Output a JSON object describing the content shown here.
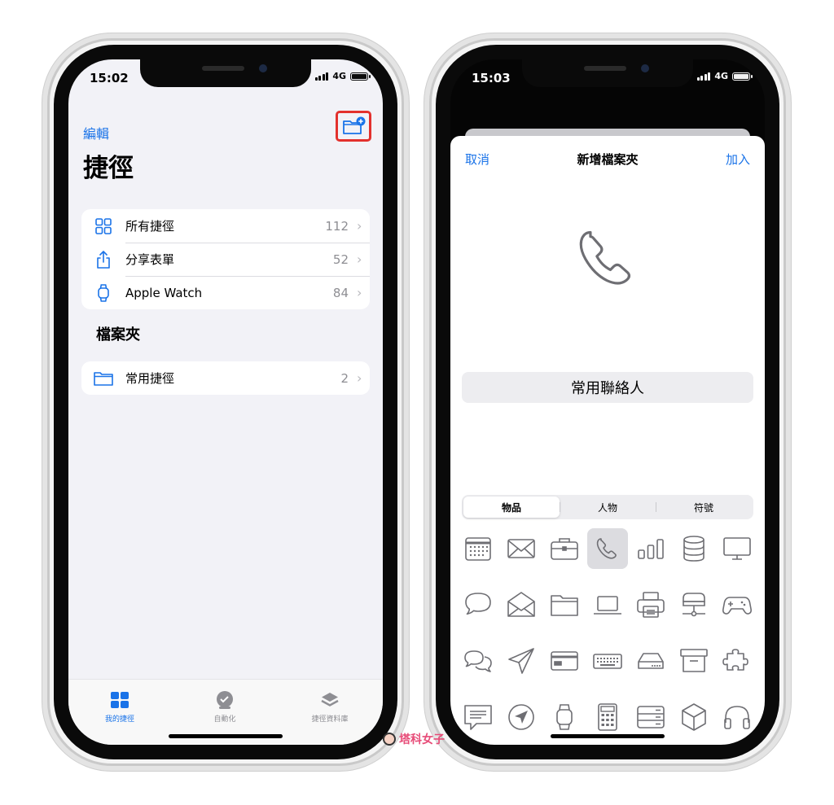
{
  "left_phone": {
    "status": {
      "time": "15:02",
      "network": "4G"
    },
    "header": {
      "edit": "編輯",
      "title": "捷徑",
      "new_folder_icon": "folder-badge-plus-icon"
    },
    "library": [
      {
        "icon": "grid-icon",
        "label": "所有捷徑",
        "count": "112"
      },
      {
        "icon": "share-icon",
        "label": "分享表單",
        "count": "52"
      },
      {
        "icon": "watch-icon",
        "label": "Apple Watch",
        "count": "84"
      }
    ],
    "folders_section": {
      "title": "檔案夾"
    },
    "folders": [
      {
        "icon": "folder-icon",
        "label": "常用捷徑",
        "count": "2"
      }
    ],
    "tabbar": [
      {
        "icon": "grid-icon",
        "label": "我的捷徑",
        "active": true
      },
      {
        "icon": "clock-check-icon",
        "label": "自動化",
        "active": false
      },
      {
        "icon": "layers-icon",
        "label": "捷徑資料庫",
        "active": false
      }
    ]
  },
  "right_phone": {
    "status": {
      "time": "15:03",
      "network": "4G"
    },
    "sheet": {
      "cancel": "取消",
      "title": "新增檔案夾",
      "add": "加入",
      "preview_icon": "phone-icon",
      "name_value": "常用聯絡人",
      "segments": [
        "物品",
        "人物",
        "符號"
      ],
      "selected_segment": "物品",
      "icons": [
        "calendar-icon",
        "envelope-icon",
        "briefcase-icon",
        "phone-icon",
        "bar-chart-icon",
        "database-icon",
        "display-icon",
        "speech-bubble-icon",
        "envelope-open-icon",
        "folder-icon",
        "laptop-icon",
        "printer-icon",
        "network-server-icon",
        "gamecontroller-icon",
        "two-bubbles-icon",
        "paperplane-icon",
        "creditcard-icon",
        "keyboard-icon",
        "disk-drive-icon",
        "archive-box-icon",
        "puzzle-icon",
        "text-bubble-icon",
        "location-icon",
        "applewatch-icon",
        "calculator-icon",
        "server-rack-icon",
        "cube-icon",
        "headphones-icon"
      ],
      "selected_icon": "phone-icon"
    }
  },
  "watermark": {
    "text": "塔科女子"
  },
  "colors": {
    "accent": "#1a73e8",
    "highlight": "#e3312d",
    "icon_gray": "#6e6e73"
  }
}
